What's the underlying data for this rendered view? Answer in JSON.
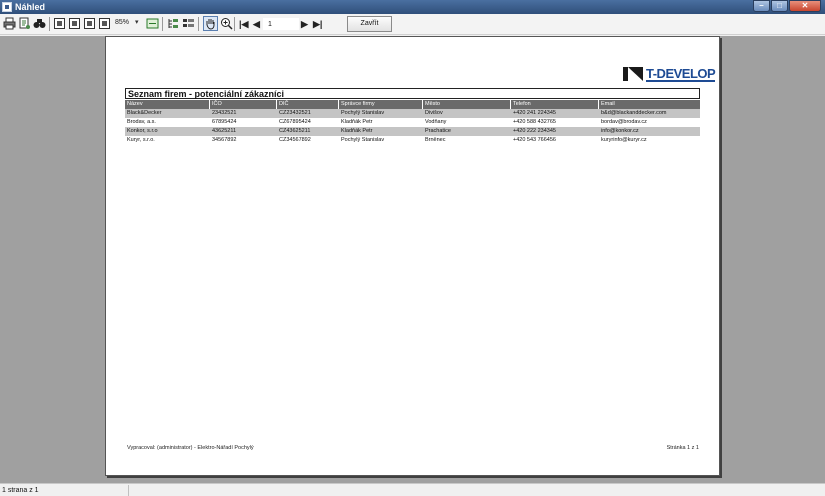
{
  "window": {
    "title": "Náhled"
  },
  "toolbar": {
    "icons": [
      "print-icon",
      "page-setup-icon",
      "find-icon",
      "one-page-icon",
      "two-pages-icon",
      "four-pages-icon",
      "grid-pages-icon",
      "fit-width-icon",
      "outline-icon",
      "thumbnails-icon",
      "hand-tool-icon",
      "zoom-tool-icon",
      "first-page-icon",
      "prev-page-icon",
      "next-page-icon",
      "last-page-icon"
    ],
    "zoom": "85%",
    "page_number": "1",
    "close_label": "Zavřít"
  },
  "report": {
    "logo_text": "T-DEVELOP",
    "title": "Seznam firem - potenciální zákazníci",
    "columns": [
      "Název",
      "IČO",
      "DIČ",
      "Správce firmy",
      "Město",
      "Telefon",
      "Email"
    ],
    "rows": [
      [
        "Black&Decker",
        "23432521",
        "CZ23432521",
        "Pochylý Stanislav",
        "Divišov",
        "+420 241 224345",
        "b&d@blackanddecker.com"
      ],
      [
        "Brodav, a.s.",
        "67895424",
        "CZ67895424",
        "Kladňák Petr",
        "Vodňany",
        "+420 588 432765",
        "bordav@brodav.cz"
      ],
      [
        "Konkor, s.r.o",
        "43625211",
        "CZ43625211",
        "Kladňák Petr",
        "Prachatice",
        "+420 222 234345",
        "info@konkor.cz"
      ],
      [
        "Kuryr, s.r.o.",
        "34567892",
        "CZ34567892",
        "Pochylý Stanislav",
        "Brněnec",
        "+420 543 766456",
        "kuryrinfo@kuryr.cz"
      ]
    ],
    "footer_left": "Vypracoval: (administrator) - Elektro-Nářadí Pochylý",
    "footer_right": "Stránka 1 z 1"
  },
  "statusbar": {
    "text": "1 strana z 1"
  }
}
